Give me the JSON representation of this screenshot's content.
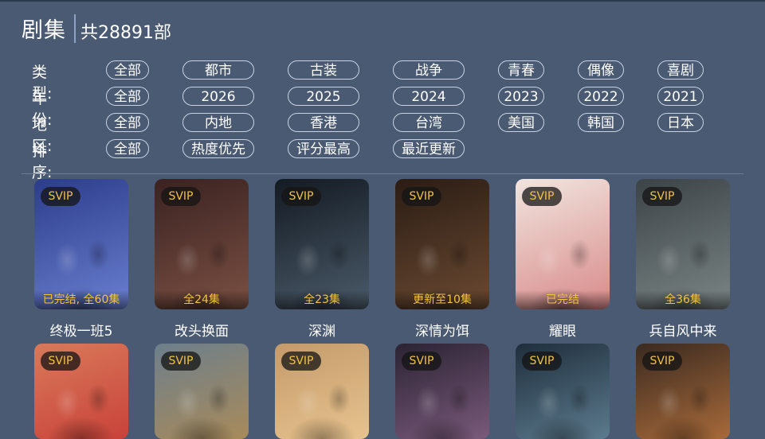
{
  "header": {
    "title": "剧集",
    "count": "共28891部"
  },
  "filters": [
    {
      "label": "类型:",
      "options": [
        "全部",
        "都市",
        "古装",
        "战争",
        "青春",
        "偶像",
        "喜剧"
      ]
    },
    {
      "label": "年份:",
      "options": [
        "全部",
        "2026",
        "2025",
        "2024",
        "2023",
        "2022",
        "2021"
      ]
    },
    {
      "label": "地区:",
      "options": [
        "全部",
        "内地",
        "香港",
        "台湾",
        "美国",
        "韩国",
        "日本"
      ]
    },
    {
      "label": "排序:",
      "options": [
        "全部",
        "热度优先",
        "评分最高",
        "最近更新"
      ]
    }
  ],
  "badge": "SVIP",
  "cards": [
    {
      "title": "终极一班5",
      "status": "已完结, 全60集",
      "colors": [
        "#2b3c8a",
        "#6a7fd0"
      ]
    },
    {
      "title": "改头换面",
      "status": "全24集",
      "colors": [
        "#3a2221",
        "#7b5043"
      ]
    },
    {
      "title": "深渊",
      "status": "全23集",
      "colors": [
        "#131a22",
        "#4b5b6a"
      ]
    },
    {
      "title": "深情为饵",
      "status": "更新至10集",
      "colors": [
        "#2a1c14",
        "#6b4a32"
      ]
    },
    {
      "title": "耀眼",
      "status": "已完结",
      "colors": [
        "#f1e5de",
        "#d88a8a"
      ]
    },
    {
      "title": "兵自风中来",
      "status": "全36集",
      "colors": [
        "#3b4347",
        "#7b8585"
      ]
    }
  ],
  "cards_row2": [
    {
      "colors": [
        "#d87a5a",
        "#c9423a"
      ]
    },
    {
      "colors": [
        "#6d7f8c",
        "#a88a5a"
      ]
    },
    {
      "colors": [
        "#c49a6a",
        "#e7c38f"
      ]
    },
    {
      "colors": [
        "#2a2333",
        "#7a5a7b"
      ]
    },
    {
      "colors": [
        "#1f2e3c",
        "#5c7b8e"
      ]
    },
    {
      "colors": [
        "#3a2a20",
        "#a86a3a"
      ]
    }
  ],
  "overlays": {
    "card0": "终极一班5",
    "card1": "改头换面",
    "card2": "深渊",
    "card3": "深情为饵",
    "card4": "耀眼",
    "card5": "兵自风中来"
  }
}
